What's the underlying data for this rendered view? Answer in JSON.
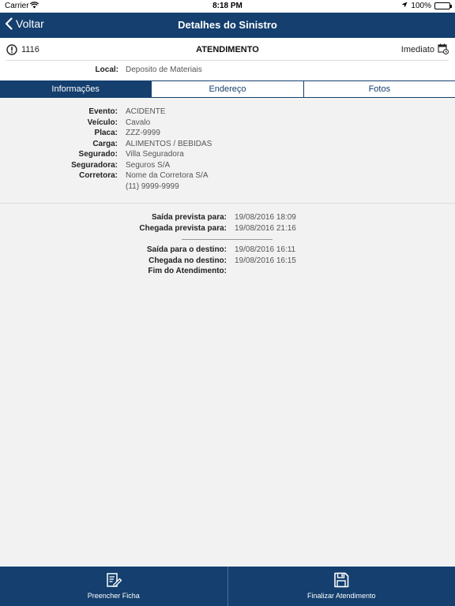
{
  "status": {
    "carrier": "Carrier",
    "time": "8:18 PM",
    "battery": "100%"
  },
  "nav": {
    "back_label": "Voltar",
    "title": "Detalhes do Sinistro",
    "bar_color": "#143f6e"
  },
  "header": {
    "number": "1116",
    "type": "ATENDIMENTO",
    "priority": "Imediato"
  },
  "local": {
    "label": "Local:",
    "value": "Deposito de Materiais"
  },
  "tabs": [
    {
      "label": "Informações",
      "active": true
    },
    {
      "label": "Endereço",
      "active": false
    },
    {
      "label": "Fotos",
      "active": false
    }
  ],
  "info": {
    "evento_label": "Evento:",
    "evento": "ACIDENTE",
    "veiculo_label": "Veículo:",
    "veiculo": "Cavalo",
    "placa_label": "Placa:",
    "placa": "ZZZ-9999",
    "carga_label": "Carga:",
    "carga": "ALIMENTOS / BEBIDAS",
    "segurado_label": "Segurado:",
    "segurado": "Villa Seguradora",
    "seguradora_label": "Seguradora:",
    "seguradora": "Seguros S/A",
    "corretora_label": "Corretora:",
    "corretora": "Nome da Corretora S/A",
    "telefone": "(11) 9999-9999"
  },
  "times": {
    "saida_prevista_label": "Saída prevista para:",
    "saida_prevista": "19/08/2016 18:09",
    "chegada_prevista_label": "Chegada prevista para:",
    "chegada_prevista": "19/08/2016 21:16",
    "saida_destino_label": "Saída para o destino:",
    "saida_destino": "19/08/2016 16:11",
    "chegada_destino_label": "Chegada no destino:",
    "chegada_destino": "19/08/2016 16:15",
    "fim_label": "Fim do Atendimento:"
  },
  "footer": {
    "fill_form_label": "Preencher Ficha",
    "fill_form_icon": "edit-form-icon",
    "finish_label": "Finalizar Atendimento",
    "finish_icon": "save-icon"
  }
}
